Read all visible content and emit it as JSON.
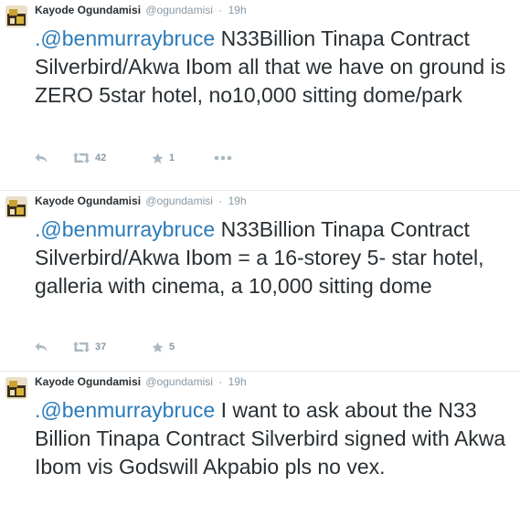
{
  "tweets": [
    {
      "name": "Kayode Ogundamisi",
      "handle": "@ogundamisi",
      "separator": "·",
      "time": "19h",
      "mention": ".@benmurraybruce",
      "body": " N33Billion Tinapa Contract Silverbird/Akwa Ibom all that we have on ground is ZERO 5star hotel, no10,000 sitting dome/park",
      "retweets": "42",
      "favorites": "1"
    },
    {
      "name": "Kayode Ogundamisi",
      "handle": "@ogundamisi",
      "separator": "·",
      "time": "19h",
      "mention": ".@benmurraybruce",
      "body": " N33Billion Tinapa Contract Silverbird/Akwa Ibom = a 16-storey 5- star hotel, galleria with cinema, a 10,000 sitting dome",
      "retweets": "37",
      "favorites": "5"
    },
    {
      "name": "Kayode Ogundamisi",
      "handle": "@ogundamisi",
      "separator": "·",
      "time": "19h",
      "mention": ".@benmurraybruce",
      "body": " I want to ask about the N33 Billion Tinapa Contract Silverbird signed with Akwa Ibom vis Godswill Akpabio pls no vex."
    }
  ],
  "icons": {
    "reply": "reply-arrow-icon",
    "retweet": "retweet-icon",
    "favorite": "star-icon",
    "more": "ellipsis-icon",
    "avatar": "avatar-photo"
  },
  "colors": {
    "text": "#292f33",
    "mention": "#2b7bb9",
    "meta": "#8899a6",
    "action_icon": "#aab8c2",
    "divider": "#e1e8ed"
  }
}
